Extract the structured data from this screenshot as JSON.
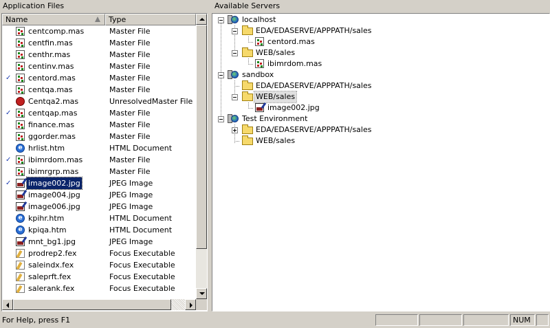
{
  "left_panel": {
    "title": "Application Files",
    "columns": {
      "name": "Name",
      "type": "Type"
    },
    "files": [
      {
        "name": "centcomp.mas",
        "type": "Master File",
        "icon": "master-file-icon",
        "checked": false
      },
      {
        "name": "centfin.mas",
        "type": "Master File",
        "icon": "master-file-icon",
        "checked": false
      },
      {
        "name": "centhr.mas",
        "type": "Master File",
        "icon": "master-file-icon",
        "checked": false
      },
      {
        "name": "centinv.mas",
        "type": "Master File",
        "icon": "master-file-icon",
        "checked": false
      },
      {
        "name": "centord.mas",
        "type": "Master File",
        "icon": "master-file-icon",
        "checked": true
      },
      {
        "name": "centqa.mas",
        "type": "Master File",
        "icon": "master-file-icon",
        "checked": false
      },
      {
        "name": "Centqa2.mas",
        "type": "UnresolvedMaster File",
        "icon": "unresolved-master-icon",
        "checked": false
      },
      {
        "name": "centqap.mas",
        "type": "Master File",
        "icon": "master-file-icon",
        "checked": true
      },
      {
        "name": "finance.mas",
        "type": "Master File",
        "icon": "master-file-icon",
        "checked": false
      },
      {
        "name": "ggorder.mas",
        "type": "Master File",
        "icon": "master-file-icon",
        "checked": false
      },
      {
        "name": "hrlist.htm",
        "type": "HTML Document",
        "icon": "html-document-icon",
        "checked": false
      },
      {
        "name": "ibimrdom.mas",
        "type": "Master File",
        "icon": "master-file-icon",
        "checked": true
      },
      {
        "name": "ibimrgrp.mas",
        "type": "Master File",
        "icon": "master-file-icon",
        "checked": false
      },
      {
        "name": "image002.jpg",
        "type": "JPEG Image",
        "icon": "jpeg-image-icon",
        "checked": true,
        "selected": true
      },
      {
        "name": "image004.jpg",
        "type": "JPEG Image",
        "icon": "jpeg-image-icon",
        "checked": false
      },
      {
        "name": "image006.jpg",
        "type": "JPEG Image",
        "icon": "jpeg-image-icon",
        "checked": false
      },
      {
        "name": "kpihr.htm",
        "type": "HTML Document",
        "icon": "html-document-icon",
        "checked": false
      },
      {
        "name": "kpiqa.htm",
        "type": "HTML Document",
        "icon": "html-document-icon",
        "checked": false
      },
      {
        "name": "mnt_bg1.jpg",
        "type": "JPEG Image",
        "icon": "jpeg-image-icon",
        "checked": false
      },
      {
        "name": "prodrep2.fex",
        "type": "Focus Executable",
        "icon": "focus-executable-icon",
        "checked": false
      },
      {
        "name": "saleindx.fex",
        "type": "Focus Executable",
        "icon": "focus-executable-icon",
        "checked": false
      },
      {
        "name": "saleprft.fex",
        "type": "Focus Executable",
        "icon": "focus-executable-icon",
        "checked": false
      },
      {
        "name": "salerank.fex",
        "type": "Focus Executable",
        "icon": "focus-executable-icon",
        "checked": false
      }
    ],
    "check_mark": "✓"
  },
  "right_panel": {
    "title": "Available Servers",
    "tree": [
      {
        "label": "localhost",
        "kind": "server"
      },
      {
        "label": "EDA/EDASERVE/APPPATH/sales",
        "kind": "folder"
      },
      {
        "label": "centord.mas",
        "kind": "master-file"
      },
      {
        "label": "WEB/sales",
        "kind": "folder"
      },
      {
        "label": "ibimrdom.mas",
        "kind": "master-file"
      },
      {
        "label": "sandbox",
        "kind": "server"
      },
      {
        "label": "EDA/EDASERVE/APPPATH/sales",
        "kind": "folder"
      },
      {
        "label": "WEB/sales",
        "kind": "folder"
      },
      {
        "label": "image002.jpg",
        "kind": "jpeg"
      },
      {
        "label": "Test Environment",
        "kind": "server"
      },
      {
        "label": "EDA/EDASERVE/APPPATH/sales",
        "kind": "folder"
      },
      {
        "label": "WEB/sales",
        "kind": "folder"
      }
    ]
  },
  "status_bar": {
    "text": "For Help, press F1",
    "num_indicator": "NUM"
  }
}
